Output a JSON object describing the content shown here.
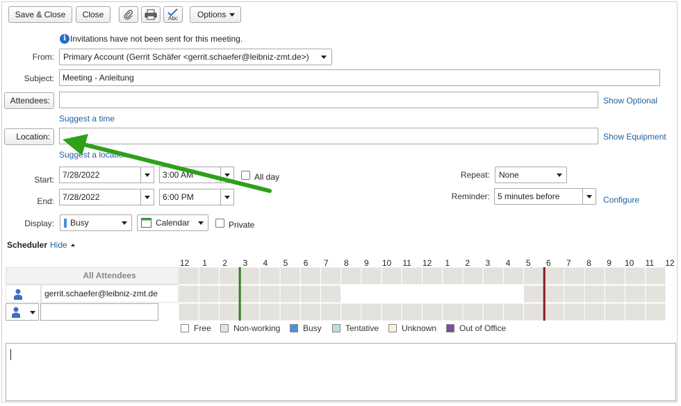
{
  "toolbar": {
    "save_close": "Save & Close",
    "close": "Close",
    "options": "Options",
    "attach_icon": "paperclip-icon",
    "print_icon": "printer-icon",
    "spell_icon": "spellcheck-icon",
    "spell_text": "Abc"
  },
  "info": {
    "icon": "info-icon",
    "glyph": "i",
    "message": "Invitations have not been sent for this meeting."
  },
  "form": {
    "from_label": "From:",
    "from_value": "Primary Account (Gerrit Schäfer <gerrit.schaefer@leibniz-zmt.de>)",
    "subject_label": "Subject:",
    "subject_value": "Meeting - Anleitung",
    "attendees_button": "Attendees:",
    "attendees_value": "",
    "show_optional": "Show Optional",
    "suggest_time": "Suggest a time",
    "location_button": "Location:",
    "location_value": "",
    "show_equipment": "Show Equipment",
    "suggest_location": "Suggest a location",
    "start_label": "Start:",
    "start_date": "7/28/2022",
    "start_time": "3:00 AM",
    "all_day": "All day",
    "end_label": "End:",
    "end_date": "7/28/2022",
    "end_time": "6:00 PM",
    "repeat_label": "Repeat:",
    "repeat_value": "None",
    "reminder_label": "Reminder:",
    "reminder_value": "5 minutes before",
    "configure": "Configure",
    "display_label": "Display:",
    "display_value": "Busy",
    "calendar_value": "Calendar",
    "private": "Private"
  },
  "scheduler": {
    "title": "Scheduler",
    "hide": "Hide",
    "all_attendees": "All Attendees",
    "hours": [
      "12",
      "1",
      "2",
      "3",
      "4",
      "5",
      "6",
      "7",
      "8",
      "9",
      "10",
      "11",
      "12",
      "1",
      "2",
      "3",
      "4",
      "5",
      "6",
      "7",
      "8",
      "9",
      "10",
      "11",
      "12"
    ],
    "attendee_email": "gerrit.schaefer@leibniz-zmt.de",
    "new_attendee_value": "",
    "legend": [
      {
        "label": "Free",
        "color": "#ffffff"
      },
      {
        "label": "Non-working",
        "color": "#e3e2dc"
      },
      {
        "label": "Busy",
        "color": "#4a90d9"
      },
      {
        "label": "Tentative",
        "color": "#b9dce6"
      },
      {
        "label": "Unknown",
        "color": "#fdf0d2"
      },
      {
        "label": "Out of Office",
        "color": "#7a4fa0"
      }
    ],
    "start_marker_color": "#2e7d1f",
    "end_marker_color": "#8b1a1a"
  },
  "annotation": {
    "arrow_color": "#2ea01a"
  }
}
